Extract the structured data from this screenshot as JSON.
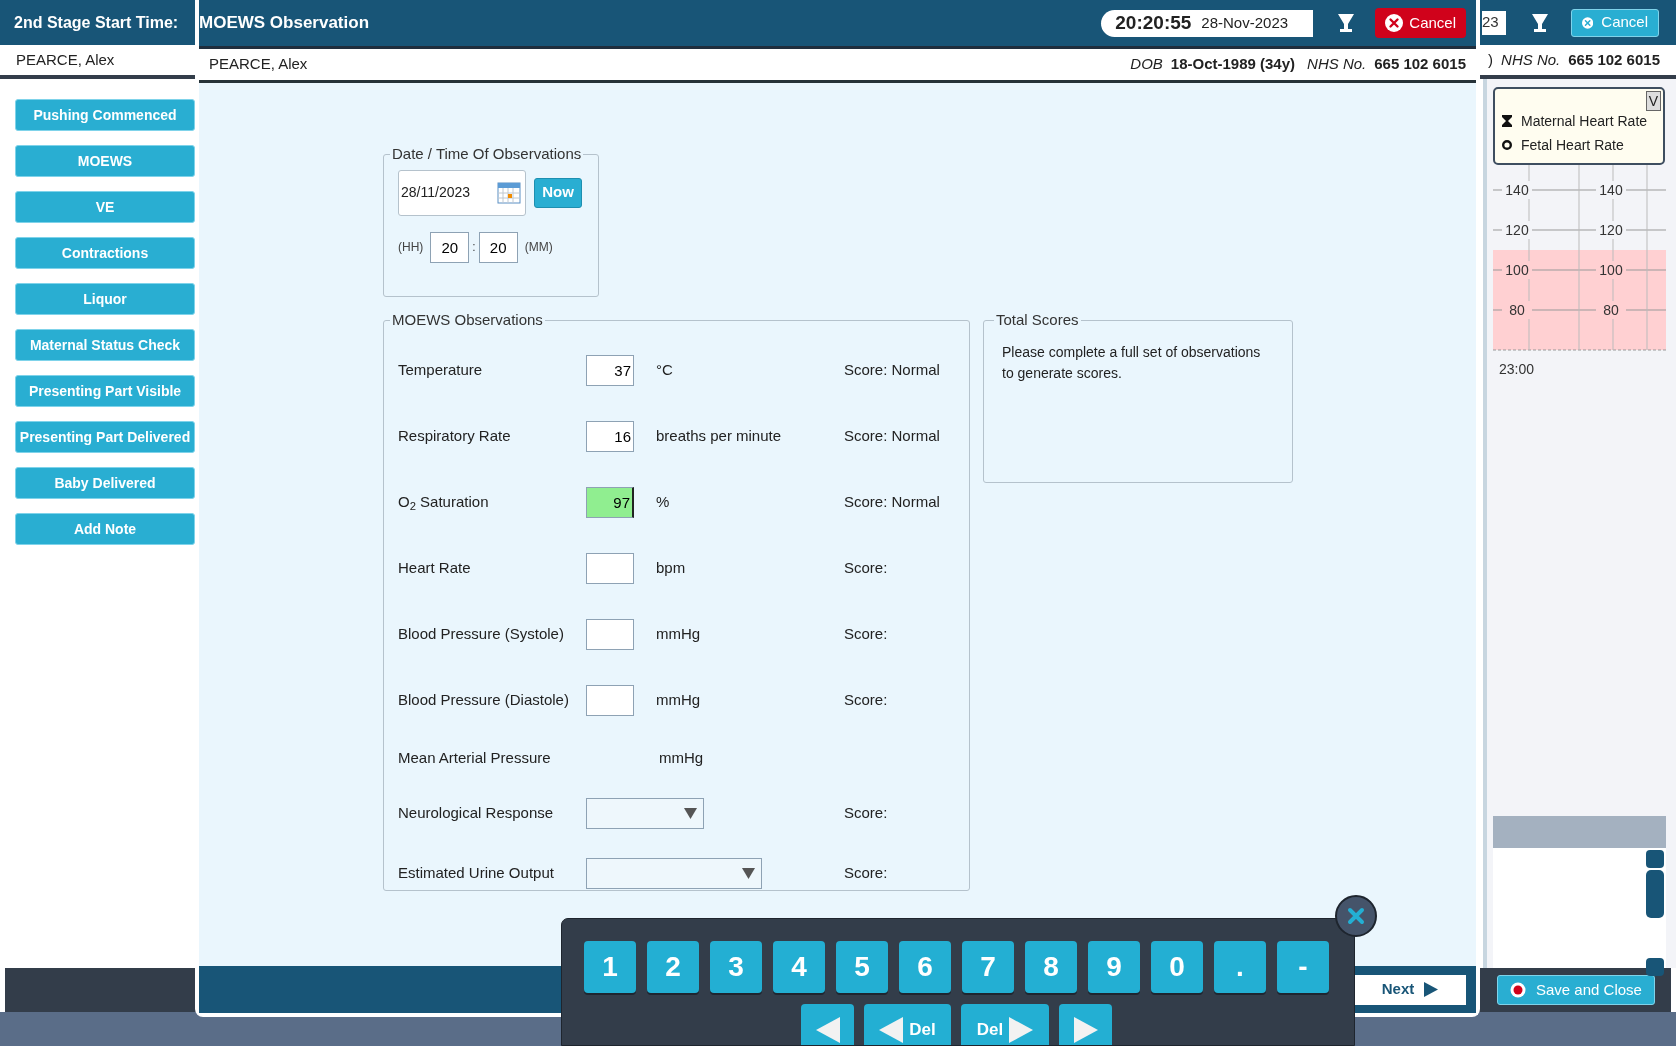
{
  "background": {
    "header_title": "2nd Stage Start Time:",
    "header_date_fragment": "23",
    "cancel_label": "Cancel",
    "patient_name": "PEARCE, Alex",
    "dob_fragment": ")",
    "nhs_label": "NHS No.",
    "nhs_number": "665 102 6015",
    "side_buttons": [
      "Pushing Commenced",
      "MOEWS",
      "VE",
      "Contractions",
      "Liquor",
      "Maternal Status Check",
      "Presenting Part Visible",
      "Presenting Part Delivered",
      "Baby Delivered",
      "Add Note"
    ],
    "chart": {
      "toggle": "V",
      "legend": [
        {
          "label": "Maternal Heart Rate",
          "kind": "hourglass"
        },
        {
          "label": "Fetal Heart Rate",
          "kind": "ring"
        }
      ],
      "axes": [
        {
          "labels": [
            "140",
            "120",
            "100",
            "80"
          ]
        },
        {
          "labels": [
            "140",
            "120",
            "100",
            "80"
          ]
        }
      ],
      "time_label": "23:00"
    },
    "save_button": "Save and Close"
  },
  "dialog": {
    "title": "MOEWS Observation",
    "clock_time": "20:20:55",
    "clock_date": "28-Nov-2023",
    "cancel_label": "Cancel",
    "patient_name": "PEARCE, Alex",
    "dob_label": "DOB",
    "dob": "18-Oct-1989 (34y)",
    "nhs_label": "NHS No.",
    "nhs_number": "665 102 6015",
    "date_time": {
      "legend": "Date / Time Of Observations",
      "date": "28/11/2023",
      "now_button": "Now",
      "hh_label": "(HH)",
      "hh": "20",
      "separator": ":",
      "mm": "20",
      "mm_label": "(MM)"
    },
    "observations": {
      "legend": "MOEWS Observations",
      "rows": [
        {
          "kind": "input",
          "label": "Temperature",
          "value": "37",
          "unit": "°C",
          "score": "Score: Normal",
          "focused": false
        },
        {
          "kind": "input",
          "label": "Respiratory Rate",
          "value": "16",
          "unit": "breaths per minute",
          "score": "Score: Normal",
          "focused": false
        },
        {
          "kind": "input",
          "label": "O$_{2}$ Saturation",
          "value": "97",
          "unit": "%",
          "score": "Score: Normal",
          "focused": true
        },
        {
          "kind": "input",
          "label": "Heart Rate",
          "unit": "bpm",
          "score": "Score:",
          "focused": false
        },
        {
          "kind": "input",
          "label": "Blood Pressure (Systole)",
          "unit": "mmHg",
          "score": "Score:",
          "focused": false
        },
        {
          "kind": "input",
          "label": "Blood Pressure (Diastole)",
          "unit": "mmHg",
          "score": "Score:",
          "focused": false
        },
        {
          "kind": "readout",
          "label": "Mean Arterial Pressure",
          "unit": "mmHg"
        },
        {
          "kind": "dropdown",
          "label": "Neurological Response",
          "score": "Score:"
        },
        {
          "kind": "dropdown",
          "label": "Estimated Urine Output",
          "score": "Score:"
        }
      ]
    },
    "total_scores": {
      "legend": "Total Scores",
      "message": "Please complete a full set of observations to generate scores."
    },
    "next_button": "Next"
  },
  "keypad": {
    "keys": [
      "1",
      "2",
      "3",
      "4",
      "5",
      "6",
      "7",
      "8",
      "9",
      "0",
      ".",
      "-"
    ],
    "nav_keys": [
      {
        "kind": "left"
      },
      {
        "kind": "del-left",
        "label": "Del"
      },
      {
        "kind": "del-right",
        "label": "Del"
      },
      {
        "kind": "right"
      }
    ]
  }
}
